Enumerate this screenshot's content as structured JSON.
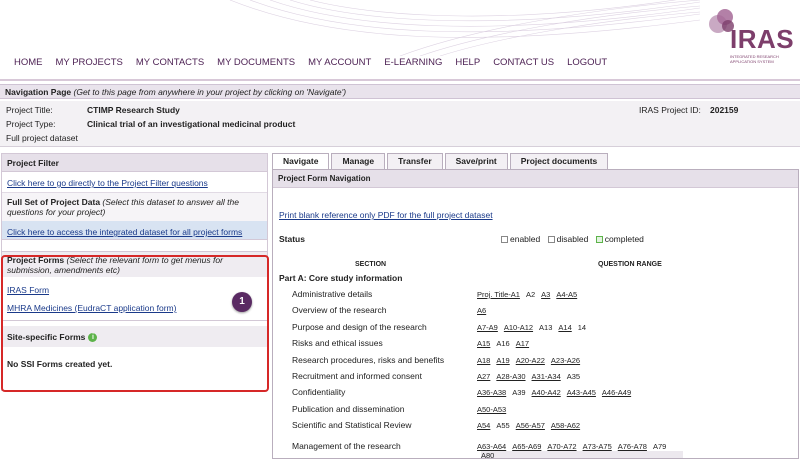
{
  "logo": {
    "text": "IRAS",
    "subtitle": "INTEGRATED RESEARCH APPLICATION SYSTEM"
  },
  "nav": [
    "HOME",
    "MY PROJECTS",
    "MY CONTACTS",
    "MY DOCUMENTS",
    "MY ACCOUNT",
    "E-LEARNING",
    "HELP",
    "CONTACT US",
    "LOGOUT"
  ],
  "navpage": {
    "title": "Navigation Page",
    "hint": "(Get to this page from anywhere in your project by clicking on 'Navigate')"
  },
  "project": {
    "title_label": "Project Title:",
    "title_value": "CTIMP Research Study",
    "type_label": "Project Type:",
    "type_value": "Clinical trial of an investigational medicinal product",
    "dataset": "Full project dataset",
    "id_label": "IRAS Project ID:",
    "id_value": "202159"
  },
  "left": {
    "filter_head": "Project Filter",
    "filter_link": "Click here to go directly to the Project Filter questions",
    "fullset_title": "Full Set of Project Data",
    "fullset_hint": "(Select this dataset to answer all the questions for your project)",
    "integrated_link": "Click here to access the integrated dataset for all project forms",
    "forms_title": "Project Forms",
    "forms_hint": "(Select the relevant form to get menus for submission, amendments etc)",
    "iras_form": "IRAS Form",
    "mhra_form": "MHRA Medicines (EudraCT application form)",
    "site_title": "Site-specific Forms",
    "no_ssi": "No SSI Forms created yet.",
    "badge": "1"
  },
  "tabs": [
    "Navigate",
    "Manage",
    "Transfer",
    "Save/print",
    "Project documents"
  ],
  "right": {
    "head": "Project Form Navigation",
    "pdf_link": "Print blank reference only PDF for the full project dataset",
    "status_label": "Status",
    "status_enabled": "enabled",
    "status_disabled": "disabled",
    "status_completed": "completed",
    "col_section": "SECTION",
    "col_range": "QUESTION RANGE",
    "part_a": "Part A: Core study information",
    "sections": [
      {
        "name": "Administrative details",
        "range": [
          "Proj. Title-A1",
          "A2",
          "A3",
          "A4-A5"
        ]
      },
      {
        "name": "Overview of the research",
        "range": [
          "A6"
        ]
      },
      {
        "name": "Purpose and design of the research",
        "range": [
          "A7-A9",
          "A10-A12",
          "A13",
          "A14",
          "14"
        ]
      },
      {
        "name": "Risks and ethical issues",
        "range": [
          "A15",
          "A16",
          "A17"
        ]
      },
      {
        "name": "Research procedures, risks and benefits",
        "range": [
          "A18",
          "A19",
          "A20-A22",
          "A23-A26"
        ]
      },
      {
        "name": "Recruitment and informed consent",
        "range": [
          "A27",
          "A28-A30",
          "A31-A34",
          "A35"
        ]
      },
      {
        "name": "Confidentiality",
        "range": [
          "A36-A38",
          "A39",
          "A40-A42",
          "A43-A45",
          "A46-A49"
        ]
      },
      {
        "name": "Publication and dissemination",
        "range": [
          "A50-A53"
        ]
      },
      {
        "name": "Scientific and Statistical Review",
        "range": [
          "A54",
          "A55",
          "A56-A57",
          "A58-A62"
        ]
      },
      {
        "name": "Management of the research",
        "range": [
          "A63-A64",
          "A65-A69",
          "A70-A72",
          "A73-A75",
          "A76-A78",
          "A79"
        ],
        "range2": [
          "A80"
        ]
      }
    ]
  },
  "colors": {
    "accent": "#5a2a63",
    "highlight": "#d62828",
    "link": "#1a3a8a"
  }
}
